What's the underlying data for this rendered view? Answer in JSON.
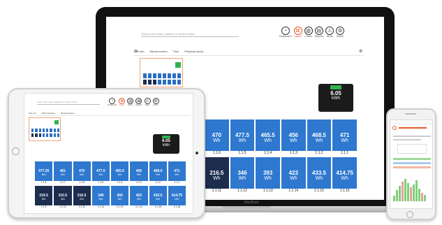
{
  "laptop": {
    "brand": "MacBook",
    "toolbar": [
      {
        "icon": "gauge-icon",
        "label": "Dashboard",
        "accent": false
      },
      {
        "icon": "network-icon",
        "label": "Layout",
        "accent": true
      },
      {
        "icon": "bar-chart-icon",
        "label": "Charts",
        "accent": false
      },
      {
        "icon": "document-icon",
        "label": "Reports",
        "accent": false
      },
      {
        "icon": "warning-icon",
        "label": "Alerts",
        "accent": false
      },
      {
        "icon": "gear-icon",
        "label": "Admin",
        "accent": false
      }
    ],
    "search_placeholder": "Search site name, address or serial number",
    "crumbs": [
      "Site info",
      "Microinverters",
      "Time",
      "Physical layout"
    ],
    "badge": {
      "value": "6.05",
      "unit": "kWh"
    },
    "grid_rows": [
      [
        {
          "value": "470",
          "unit": "Wh",
          "id": "1.1.6",
          "dark": false
        },
        {
          "value": "477.5",
          "unit": "Wh",
          "id": "1.1.5",
          "dark": false
        },
        {
          "value": "465.5",
          "unit": "Wh",
          "id": "1.1.4",
          "dark": false
        },
        {
          "value": "456",
          "unit": "Wh",
          "id": "1.1.3",
          "dark": false
        },
        {
          "value": "468.5",
          "unit": "Wh",
          "id": "1.1.2",
          "dark": false
        },
        {
          "value": "471",
          "unit": "Wh",
          "id": "1.1.1",
          "dark": false
        }
      ],
      [
        {
          "value": "216.5",
          "unit": "Wh",
          "id": "1.1.11",
          "dark": true
        },
        {
          "value": "346",
          "unit": "Wh",
          "id": "1.1.12",
          "dark": false
        },
        {
          "value": "393",
          "unit": "Wh",
          "id": "1.1.13",
          "dark": false
        },
        {
          "value": "423",
          "unit": "Wh",
          "id": "1.1.14",
          "dark": false
        },
        {
          "value": "433.5",
          "unit": "Wh",
          "id": "1.1.15",
          "dark": false
        },
        {
          "value": "414.75",
          "unit": "Wh",
          "id": "1.1.16",
          "dark": false
        }
      ]
    ]
  },
  "tablet": {
    "search_placeholder": "Search site name, address or serial number",
    "crumbs": [
      "Site info",
      "Microinverters",
      "Physical layout"
    ],
    "badge": {
      "value": "6.05",
      "unit": "kWh"
    },
    "grid_rows": [
      [
        {
          "value": "377.25",
          "unit": "Wh",
          "id": "1.1.8",
          "dark": false
        },
        {
          "value": "461",
          "unit": "Wh",
          "id": "1.1.7",
          "dark": false
        },
        {
          "value": "470",
          "unit": "Wh",
          "id": "1.1.6",
          "dark": false
        },
        {
          "value": "477.5",
          "unit": "Wh",
          "id": "1.1.5",
          "dark": false
        },
        {
          "value": "465.5",
          "unit": "Wh",
          "id": "1.1.4",
          "dark": false
        },
        {
          "value": "456",
          "unit": "Wh",
          "id": "1.1.3",
          "dark": false
        },
        {
          "value": "468.5",
          "unit": "Wh",
          "id": "1.1.2",
          "dark": false
        },
        {
          "value": "471",
          "unit": "Wh",
          "id": "1.1.1",
          "dark": false
        }
      ],
      [
        {
          "value": "219.5",
          "unit": "Wh",
          "id": "1.1.9",
          "dark": true
        },
        {
          "value": "210.5",
          "unit": "Wh",
          "id": "1.1.10",
          "dark": true
        },
        {
          "value": "216.5",
          "unit": "Wh",
          "id": "1.1.11",
          "dark": true
        },
        {
          "value": "346",
          "unit": "Wh",
          "id": "1.1.12",
          "dark": false
        },
        {
          "value": "393",
          "unit": "Wh",
          "id": "1.1.13",
          "dark": false
        },
        {
          "value": "423",
          "unit": "Wh",
          "id": "1.1.14",
          "dark": false
        },
        {
          "value": "433.5",
          "unit": "Wh",
          "id": "1.1.15",
          "dark": false
        },
        {
          "value": "414.75",
          "unit": "Wh",
          "id": "1.1.16",
          "dark": false
        }
      ]
    ]
  },
  "colors": {
    "panel": "#2e78cf",
    "panel_dark": "#1c2d4e",
    "accent": "#e05a2b",
    "badge_green": "#31b34a"
  }
}
